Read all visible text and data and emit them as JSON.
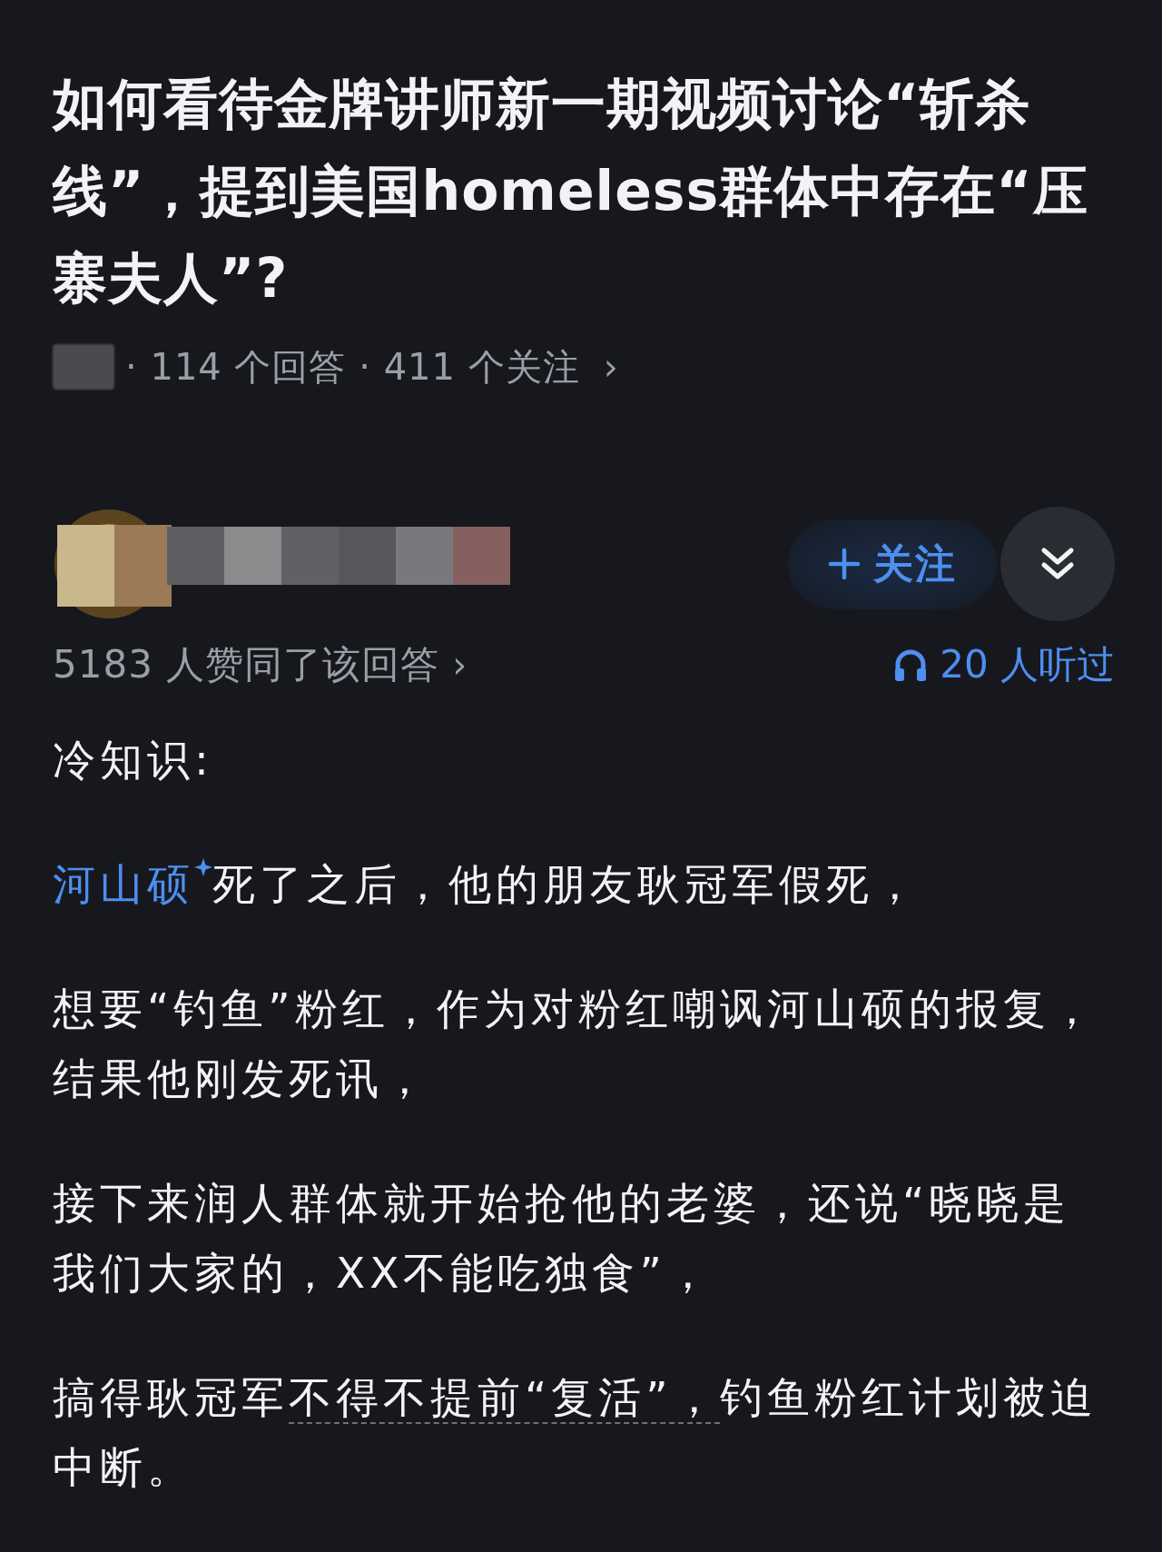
{
  "question": {
    "title": "如何看待金牌讲师新一期视频讨论“斩杀线”，提到美国homeless群体中存在“压寨夫人”?",
    "meta": "· 114 个回答 · 411 个关注",
    "meta_arrow": "›"
  },
  "answer": {
    "follow_button": {
      "label": "关注"
    },
    "likes": "5183 人赞同了该回答",
    "likes_arrow": "›",
    "listened": "20 人听过",
    "paragraphs": [
      [
        {
          "kind": "text",
          "text": "冷知识:"
        }
      ],
      [
        {
          "kind": "link",
          "text": "河山硕"
        },
        {
          "kind": "text",
          "text": "死了之后，他的朋友耿冠军假死，"
        }
      ],
      [
        {
          "kind": "text",
          "text": "想要“钓鱼”粉红，作为对粉红嘲讽河山硕的报复，结果他刚发死讯，"
        }
      ],
      [
        {
          "kind": "text",
          "text": "接下来润人群体就开始抢他的老婆，还说“晓晓是我们大家的，XX不能吃独食”，"
        }
      ],
      [
        {
          "kind": "text",
          "text": "搞得耿冠军"
        },
        {
          "kind": "keyword",
          "text": "不得不提前“复活”，"
        },
        {
          "kind": "text",
          "text": "钓鱼粉红计划被迫中断。"
        }
      ]
    ]
  }
}
